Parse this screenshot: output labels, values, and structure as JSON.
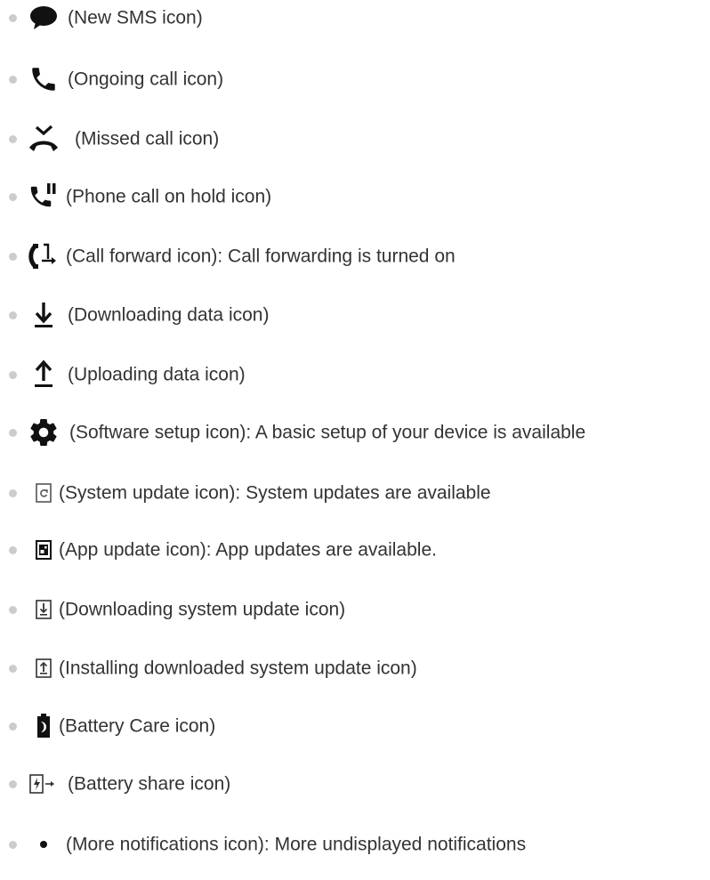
{
  "colors": {
    "text": "#333333",
    "icon": "#111111",
    "bullet": "#cccccc"
  },
  "items": [
    {
      "icon": "new-sms-icon",
      "text": "(New SMS icon)"
    },
    {
      "icon": "ongoing-call-icon",
      "text": "(Ongoing call icon)"
    },
    {
      "icon": "missed-call-icon",
      "text": "(Missed call icon)"
    },
    {
      "icon": "call-on-hold-icon",
      "text": "(Phone call on hold icon)"
    },
    {
      "icon": "call-forward-icon",
      "text": "(Call forward icon): Call forwarding is turned on"
    },
    {
      "icon": "download-icon",
      "text": "(Downloading data icon)"
    },
    {
      "icon": "upload-icon",
      "text": "(Uploading data icon)"
    },
    {
      "icon": "software-setup-icon",
      "text": "(Software setup icon): A basic setup of your device is available"
    },
    {
      "icon": "system-update-icon",
      "text": "(System update icon): System updates are available"
    },
    {
      "icon": "app-update-icon",
      "text": "(App update icon): App updates are available."
    },
    {
      "icon": "downloading-system-update-icon",
      "text": "(Downloading system update icon)"
    },
    {
      "icon": "installing-system-update-icon",
      "text": "(Installing downloaded system update icon)"
    },
    {
      "icon": "battery-care-icon",
      "text": "(Battery Care icon)"
    },
    {
      "icon": "battery-share-icon",
      "text": "(Battery share icon)"
    },
    {
      "icon": "more-notifications-icon",
      "text": "(More notifications icon): More undisplayed notifications"
    }
  ]
}
